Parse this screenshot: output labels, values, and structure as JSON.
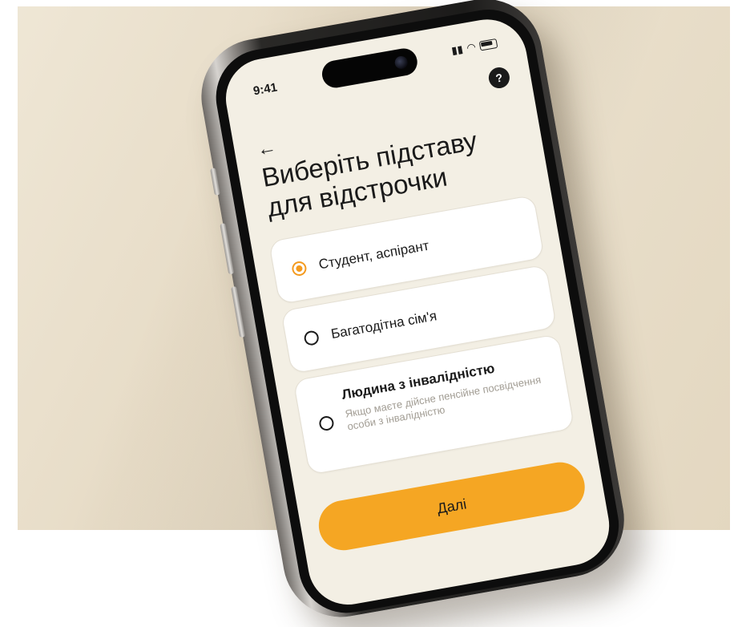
{
  "status_bar": {
    "time": "9:41"
  },
  "header": {
    "help_label": "?",
    "back_label": "←"
  },
  "title": "Виберіть підставу для відстрочки",
  "options": [
    {
      "label": "Студент, аспірант",
      "selected": true
    },
    {
      "label": "Багатодітна сім'я",
      "selected": false
    },
    {
      "label": "Людина з інвалідністю",
      "sublabel": "Якщо маєте дійсне пенсійне посвідчення особи з інвалідністю",
      "selected": false
    }
  ],
  "next_button": {
    "label": "Далі"
  },
  "colors": {
    "accent": "#f5a623",
    "screen_bg": "#f3efe4"
  },
  "icons": [
    "back-arrow-icon",
    "help-icon",
    "signal-icon",
    "wifi-icon",
    "battery-icon"
  ]
}
